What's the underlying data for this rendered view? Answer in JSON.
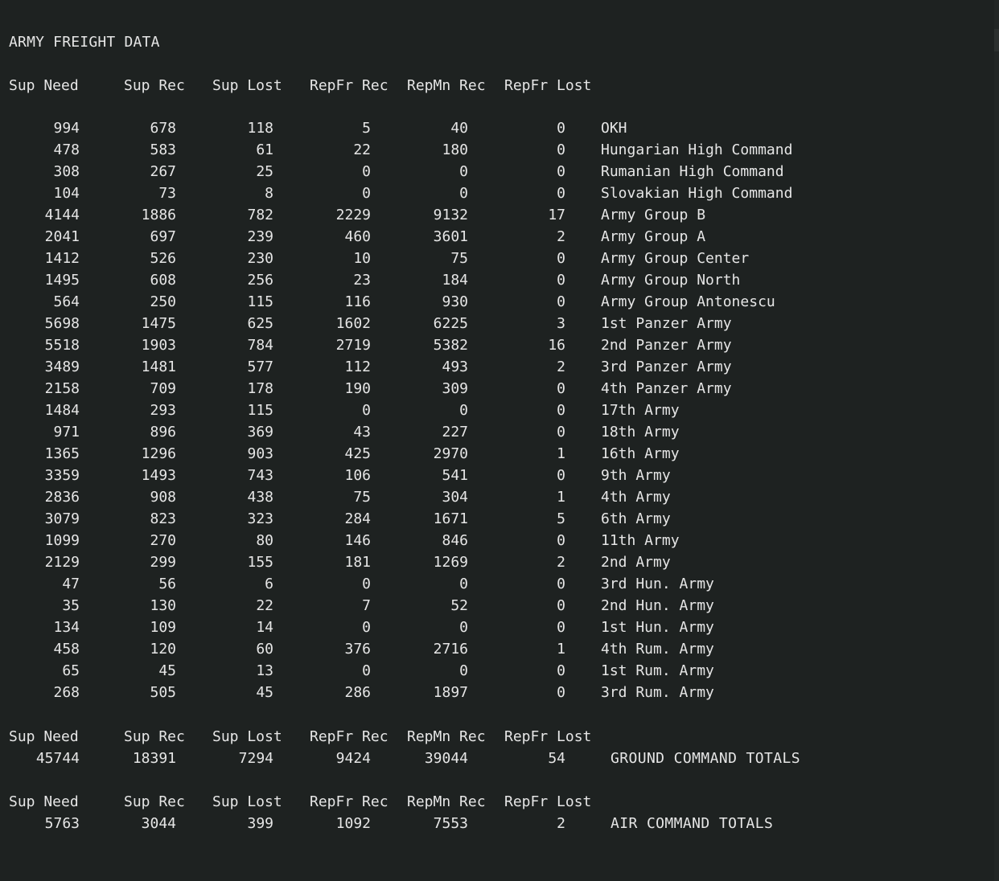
{
  "title": "ARMY FREIGHT DATA",
  "headers": [
    "Sup Need",
    "Sup Rec",
    "Sup Lost",
    "RepFr Rec",
    "RepMn Rec",
    "RepFr Lost"
  ],
  "rows": [
    {
      "sup_need": "994",
      "sup_rec": "678",
      "sup_lost": "118",
      "repfr_rec": "5",
      "repmn_rec": "40",
      "repfr_lost": "0",
      "name": "OKH"
    },
    {
      "sup_need": "478",
      "sup_rec": "583",
      "sup_lost": "61",
      "repfr_rec": "22",
      "repmn_rec": "180",
      "repfr_lost": "0",
      "name": "Hungarian High Command"
    },
    {
      "sup_need": "308",
      "sup_rec": "267",
      "sup_lost": "25",
      "repfr_rec": "0",
      "repmn_rec": "0",
      "repfr_lost": "0",
      "name": "Rumanian High Command"
    },
    {
      "sup_need": "104",
      "sup_rec": "73",
      "sup_lost": "8",
      "repfr_rec": "0",
      "repmn_rec": "0",
      "repfr_lost": "0",
      "name": "Slovakian High Command"
    },
    {
      "sup_need": "4144",
      "sup_rec": "1886",
      "sup_lost": "782",
      "repfr_rec": "2229",
      "repmn_rec": "9132",
      "repfr_lost": "17",
      "name": "Army Group B"
    },
    {
      "sup_need": "2041",
      "sup_rec": "697",
      "sup_lost": "239",
      "repfr_rec": "460",
      "repmn_rec": "3601",
      "repfr_lost": "2",
      "name": "Army Group A"
    },
    {
      "sup_need": "1412",
      "sup_rec": "526",
      "sup_lost": "230",
      "repfr_rec": "10",
      "repmn_rec": "75",
      "repfr_lost": "0",
      "name": "Army Group Center"
    },
    {
      "sup_need": "1495",
      "sup_rec": "608",
      "sup_lost": "256",
      "repfr_rec": "23",
      "repmn_rec": "184",
      "repfr_lost": "0",
      "name": "Army Group North"
    },
    {
      "sup_need": "564",
      "sup_rec": "250",
      "sup_lost": "115",
      "repfr_rec": "116",
      "repmn_rec": "930",
      "repfr_lost": "0",
      "name": "Army Group Antonescu"
    },
    {
      "sup_need": "5698",
      "sup_rec": "1475",
      "sup_lost": "625",
      "repfr_rec": "1602",
      "repmn_rec": "6225",
      "repfr_lost": "3",
      "name": "1st Panzer Army"
    },
    {
      "sup_need": "5518",
      "sup_rec": "1903",
      "sup_lost": "784",
      "repfr_rec": "2719",
      "repmn_rec": "5382",
      "repfr_lost": "16",
      "name": "2nd Panzer Army"
    },
    {
      "sup_need": "3489",
      "sup_rec": "1481",
      "sup_lost": "577",
      "repfr_rec": "112",
      "repmn_rec": "493",
      "repfr_lost": "2",
      "name": "3rd Panzer Army"
    },
    {
      "sup_need": "2158",
      "sup_rec": "709",
      "sup_lost": "178",
      "repfr_rec": "190",
      "repmn_rec": "309",
      "repfr_lost": "0",
      "name": "4th Panzer Army"
    },
    {
      "sup_need": "1484",
      "sup_rec": "293",
      "sup_lost": "115",
      "repfr_rec": "0",
      "repmn_rec": "0",
      "repfr_lost": "0",
      "name": "17th Army"
    },
    {
      "sup_need": "971",
      "sup_rec": "896",
      "sup_lost": "369",
      "repfr_rec": "43",
      "repmn_rec": "227",
      "repfr_lost": "0",
      "name": "18th Army"
    },
    {
      "sup_need": "1365",
      "sup_rec": "1296",
      "sup_lost": "903",
      "repfr_rec": "425",
      "repmn_rec": "2970",
      "repfr_lost": "1",
      "name": "16th Army"
    },
    {
      "sup_need": "3359",
      "sup_rec": "1493",
      "sup_lost": "743",
      "repfr_rec": "106",
      "repmn_rec": "541",
      "repfr_lost": "0",
      "name": "9th Army"
    },
    {
      "sup_need": "2836",
      "sup_rec": "908",
      "sup_lost": "438",
      "repfr_rec": "75",
      "repmn_rec": "304",
      "repfr_lost": "1",
      "name": "4th Army"
    },
    {
      "sup_need": "3079",
      "sup_rec": "823",
      "sup_lost": "323",
      "repfr_rec": "284",
      "repmn_rec": "1671",
      "repfr_lost": "5",
      "name": "6th Army"
    },
    {
      "sup_need": "1099",
      "sup_rec": "270",
      "sup_lost": "80",
      "repfr_rec": "146",
      "repmn_rec": "846",
      "repfr_lost": "0",
      "name": "11th Army"
    },
    {
      "sup_need": "2129",
      "sup_rec": "299",
      "sup_lost": "155",
      "repfr_rec": "181",
      "repmn_rec": "1269",
      "repfr_lost": "2",
      "name": "2nd Army"
    },
    {
      "sup_need": "47",
      "sup_rec": "56",
      "sup_lost": "6",
      "repfr_rec": "0",
      "repmn_rec": "0",
      "repfr_lost": "0",
      "name": "3rd Hun. Army"
    },
    {
      "sup_need": "35",
      "sup_rec": "130",
      "sup_lost": "22",
      "repfr_rec": "7",
      "repmn_rec": "52",
      "repfr_lost": "0",
      "name": "2nd Hun. Army"
    },
    {
      "sup_need": "134",
      "sup_rec": "109",
      "sup_lost": "14",
      "repfr_rec": "0",
      "repmn_rec": "0",
      "repfr_lost": "0",
      "name": "1st Hun. Army"
    },
    {
      "sup_need": "458",
      "sup_rec": "120",
      "sup_lost": "60",
      "repfr_rec": "376",
      "repmn_rec": "2716",
      "repfr_lost": "1",
      "name": "4th Rum. Army"
    },
    {
      "sup_need": "65",
      "sup_rec": "45",
      "sup_lost": "13",
      "repfr_rec": "0",
      "repmn_rec": "0",
      "repfr_lost": "0",
      "name": "1st Rum. Army"
    },
    {
      "sup_need": "268",
      "sup_rec": "505",
      "sup_lost": "45",
      "repfr_rec": "286",
      "repmn_rec": "1897",
      "repfr_lost": "0",
      "name": "3rd Rum. Army"
    }
  ],
  "ground_totals": {
    "sup_need": "45744",
    "sup_rec": "18391",
    "sup_lost": "7294",
    "repfr_rec": "9424",
    "repmn_rec": "39044",
    "repfr_lost": "54",
    "name": "GROUND COMMAND TOTALS"
  },
  "air_totals": {
    "sup_need": "5763",
    "sup_rec": "3044",
    "sup_lost": "399",
    "repfr_rec": "1092",
    "repmn_rec": "7553",
    "repfr_lost": "2",
    "name": "AIR COMMAND TOTALS"
  }
}
